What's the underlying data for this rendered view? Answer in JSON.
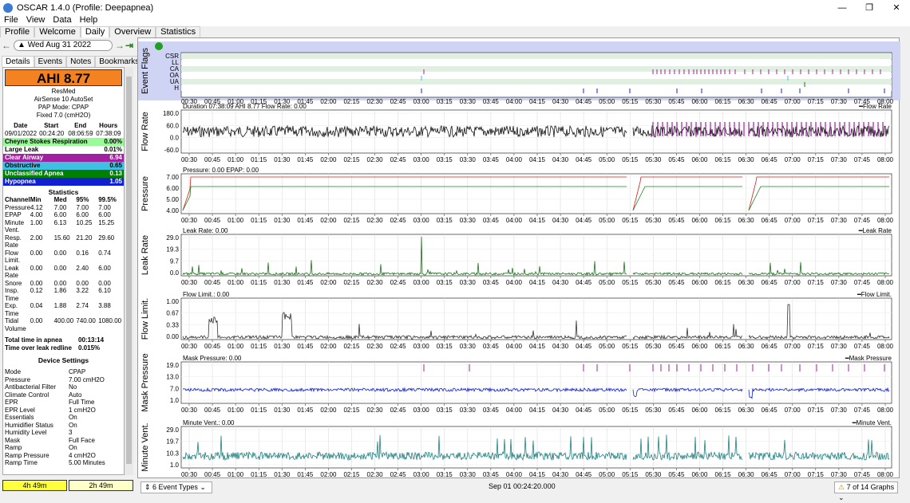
{
  "window": {
    "title": "OSCAR 1.4.0 (Profile: Deepapnea)"
  },
  "menu": [
    "File",
    "View",
    "Data",
    "Help"
  ],
  "tabs": [
    "Profile",
    "Welcome",
    "Daily",
    "Overview",
    "Statistics"
  ],
  "date": "Wed Aug 31 2022",
  "subtabs": [
    "Details",
    "Events",
    "Notes",
    "Bookmarks"
  ],
  "ahi": "AHI 8.77",
  "device": {
    "brand": "ResMed",
    "model": "AirSense 10 AutoSet",
    "mode": "PAP Mode: CPAP",
    "fixed": "Fixed 7.0 (cmH2O)"
  },
  "session": {
    "headers": [
      "Date",
      "Start",
      "End",
      "Hours"
    ],
    "values": [
      "09/01/2022",
      "00:24:20",
      "08:06:59",
      "07:38:09"
    ]
  },
  "events": [
    {
      "name": "Cheyne Stokes Respiration",
      "value": "0.00%",
      "color": "#98fb98"
    },
    {
      "name": "Large Leak",
      "value": "0.01%",
      "color": "#ffffff"
    },
    {
      "name": "Clear Airway",
      "value": "6.94",
      "color": "#a020a0"
    },
    {
      "name": "Obstructive",
      "value": "0.65",
      "color": "#40c0e0"
    },
    {
      "name": "Unclassified Apnea",
      "value": "0.13",
      "color": "#008000"
    },
    {
      "name": "Hypopnea",
      "value": "1.05",
      "color": "#1020d0"
    }
  ],
  "stats_title": "Statistics",
  "stats_headers": [
    "Channel",
    "Min",
    "Med",
    "95%",
    "99.5%"
  ],
  "stats": [
    [
      "Pressure",
      "4.12",
      "7.00",
      "7.00",
      "7.00"
    ],
    [
      "EPAP",
      "4.00",
      "6.00",
      "6.00",
      "6.00"
    ],
    [
      "Minute Vent.",
      "1.00",
      "6.13",
      "10.25",
      "15.25"
    ],
    [
      "Resp. Rate",
      "2.00",
      "15.60",
      "21.20",
      "29.60"
    ],
    [
      "Flow Limit.",
      "0.00",
      "0.00",
      "0.16",
      "0.74"
    ],
    [
      "Leak Rate",
      "0.00",
      "0.00",
      "2.40",
      "6.00"
    ],
    [
      "Snore",
      "0.00",
      "0.00",
      "0.00",
      "0.00"
    ],
    [
      "Insp. Time",
      "0.12",
      "1.86",
      "3.22",
      "6.10"
    ],
    [
      "Exp. Time",
      "0.04",
      "1.88",
      "2.74",
      "3.88"
    ],
    [
      "Tidal Volume",
      "0.00",
      "400.00",
      "740.00",
      "1080.00"
    ]
  ],
  "totals": [
    [
      "Total time in apnea",
      "00:13:14"
    ],
    [
      "Time over leak redline",
      "0.015%"
    ]
  ],
  "device_settings_title": "Device Settings",
  "device_settings": [
    [
      "Mode",
      "CPAP"
    ],
    [
      "Pressure",
      "7.00 cmH2O"
    ],
    [
      "Antibacterial Filter",
      "No"
    ],
    [
      "Climate Control",
      "Auto"
    ],
    [
      "EPR",
      "Full Time"
    ],
    [
      "EPR Level",
      "1 cmH2O"
    ],
    [
      "Essentials",
      "On"
    ],
    [
      "Humidifier Status",
      "On"
    ],
    [
      "Humidity Level",
      "3"
    ],
    [
      "Mask",
      "Full Face"
    ],
    [
      "Ramp",
      "On"
    ],
    [
      "Ramp Pressure",
      "4 cmH2O"
    ],
    [
      "Ramp Time",
      "5.00 Minutes"
    ]
  ],
  "bottom": [
    "4h 49m",
    "2h 49m"
  ],
  "footer": {
    "event_types": "6 Event Types",
    "time": "Sep 01 00:24:20.000",
    "graphs": "7 of 14 Graphs"
  },
  "graphs": {
    "time_labels": [
      "00:30",
      "00:45",
      "01:00",
      "01:15",
      "01:30",
      "01:45",
      "02:00",
      "02:15",
      "02:30",
      "02:45",
      "03:00",
      "03:15",
      "03:30",
      "03:45",
      "04:00",
      "04:15",
      "04:30",
      "04:45",
      "05:00",
      "05:15",
      "05:30",
      "05:45",
      "06:00",
      "06:15",
      "06:30",
      "06:45",
      "07:00",
      "07:15",
      "07:30",
      "07:45",
      "08:00"
    ],
    "event_flags": {
      "title": "Event Flags",
      "rows": [
        "CSR",
        "LL",
        "CA",
        "OA",
        "UA",
        "H"
      ]
    },
    "flow_rate": {
      "title": "Flow Rate",
      "header": "Duration 07:38:09 AHI 8.77 Flow Rate: 0.00",
      "legend": "Flow Rate",
      "yticks": [
        "180.0",
        "60.0",
        "0.0",
        "-60.0"
      ]
    },
    "pressure": {
      "title": "Pressure",
      "header": "Pressure: 0.00 EPAP: 0.00",
      "legend_a": "EPAP",
      "legend_b": "Pressure",
      "yticks": [
        "7.00",
        "6.00",
        "5.00",
        "4.00"
      ]
    },
    "leak_rate": {
      "title": "Leak Rate",
      "header": "Leak Rate: 0.00",
      "legend": "Leak Rate",
      "yticks": [
        "29.0",
        "19.3",
        "9.7",
        "0.0"
      ]
    },
    "flow_limit": {
      "title": "Flow Limit.",
      "header": "Flow Limit.: 0.00",
      "legend": "Flow Limit.",
      "yticks": [
        "1.00",
        "0.67",
        "0.33",
        "0.00"
      ]
    },
    "mask_pressure": {
      "title": "Mask Pressure",
      "header": "Mask Pressure: 0.00",
      "legend": "Mask Pressure",
      "yticks": [
        "19.0",
        "13.0",
        "7.0",
        "1.0"
      ]
    },
    "minute_vent": {
      "title": "Minute Vent.",
      "header": "Minute Vent.: 0.00",
      "legend": "Minute Vent.",
      "yticks": [
        "29.0",
        "19.7",
        "10.3",
        "1.0"
      ]
    }
  }
}
